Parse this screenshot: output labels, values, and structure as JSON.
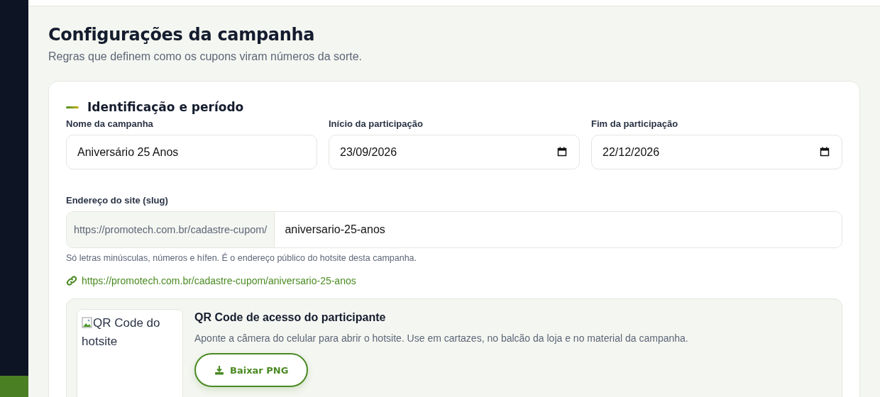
{
  "page": {
    "title": "Configurações da campanha",
    "subtitle": "Regras que definem como os cupons viram números da sorte."
  },
  "section": {
    "title": "Identificação e período",
    "fields": [
      {
        "kind": "text",
        "label": "Nome da campanha",
        "value": "Aniversário 25 Anos"
      },
      {
        "kind": "date",
        "label": "Início da participação",
        "value": "23/09/2026"
      },
      {
        "kind": "date",
        "label": "Fim da participação",
        "value": "22/12/2026"
      }
    ],
    "slug": {
      "label": "Endereço do site (slug)",
      "prefix": "https://promotech.com.br/cadastre-cupom/",
      "value": "aniversario-25-anos",
      "hint": "Só letras minúsculas, números e hífen. É o endereço público do hotsite desta campanha.",
      "link": "https://promotech.com.br/cadastre-cupom/aniversario-25-anos"
    },
    "qr": {
      "image_alt": "QR Code do hotsite",
      "title": "QR Code de acesso do participante",
      "description": "Aponte a câmera do celular para abrir o hotsite. Use em cartazes, no balcão da loja e no material da campanha.",
      "button": "Baixar PNG"
    }
  }
}
